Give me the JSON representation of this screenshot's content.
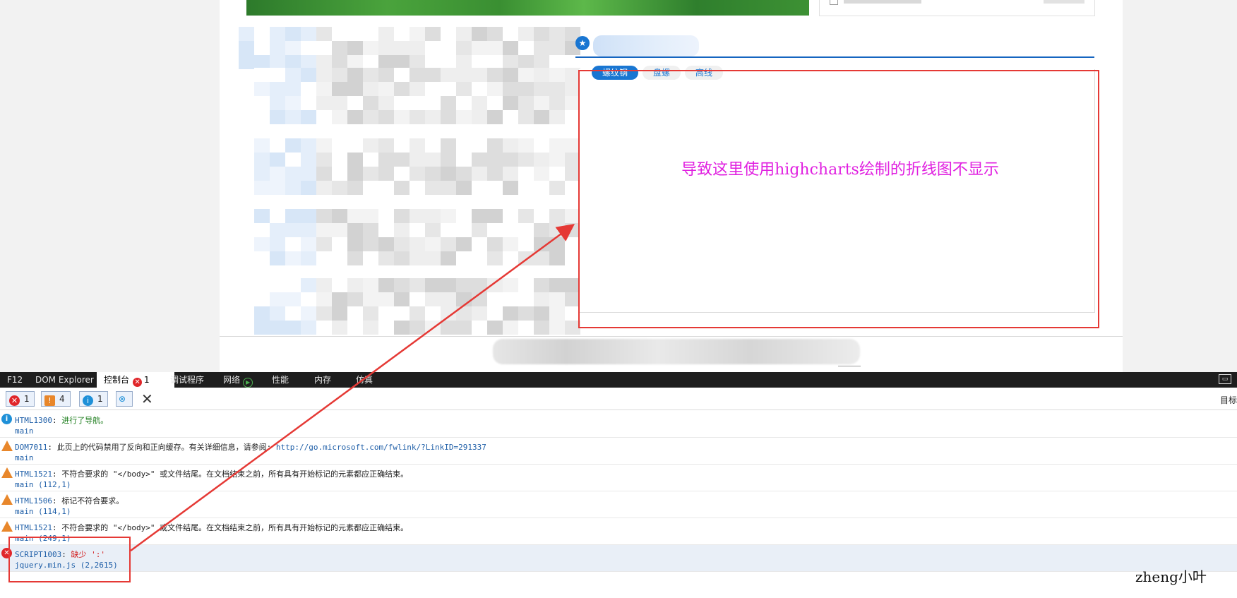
{
  "section": {
    "tabs": [
      {
        "label": "螺纹钢",
        "active": true
      },
      {
        "label": "盘螺",
        "active": false
      },
      {
        "label": "高线",
        "active": false
      }
    ]
  },
  "annotation": {
    "text": "导致这里使用highcharts绘制的折线图不显示",
    "color": "#e020e0"
  },
  "devtools": {
    "tabs": [
      {
        "label": "F12"
      },
      {
        "label": "DOM Explorer"
      },
      {
        "label": "控制台",
        "badge": "1",
        "active": true
      },
      {
        "label": "调试程序"
      },
      {
        "label": "网络"
      },
      {
        "label": "性能"
      },
      {
        "label": "内存"
      },
      {
        "label": "仿真"
      }
    ],
    "filters": {
      "errors": "1",
      "warnings": "4",
      "info": "1"
    },
    "target_label": "目标",
    "messages": [
      {
        "level": "info",
        "code": "HTML1300",
        "sep": ":",
        "text": "进行了导航。",
        "source": "main"
      },
      {
        "level": "warn",
        "code": "DOM7011",
        "sep": ":",
        "text": "此页上的代码禁用了反向和正向缓存。有关详细信息，请参阅: ",
        "link": "http://go.microsoft.com/fwlink/?LinkID=291337",
        "source": "main"
      },
      {
        "level": "warn",
        "code": "HTML1521",
        "sep": ":",
        "text": "不符合要求的 \"</body>\" 或文件结尾。在文档结束之前，所有具有开始标记的元素都应正确结束。",
        "source": "main (112,1)"
      },
      {
        "level": "warn",
        "code": "HTML1506",
        "sep": ":",
        "text": "标记不符合要求。",
        "source": "main (114,1)"
      },
      {
        "level": "warn",
        "code": "HTML1521",
        "sep": ":",
        "text": "不符合要求的 \"</body>\" 或文件结尾。在文档结束之前，所有具有开始标记的元素都应正确结束。",
        "source": "main (249,1)"
      },
      {
        "level": "error",
        "code": "SCRIPT1003",
        "sep": ":",
        "text": "缺少 ':'",
        "source": "jquery.min.js (2,2615)"
      }
    ],
    "colors": {
      "error": "#e0262a",
      "warning": "#e8872b",
      "info": "#1e90d8",
      "accent": "#1976d2"
    }
  },
  "icons": {
    "star": "★",
    "clear": "✕",
    "error": "✕",
    "warning": "!",
    "info": "i"
  },
  "watermark": "zheng小叶"
}
